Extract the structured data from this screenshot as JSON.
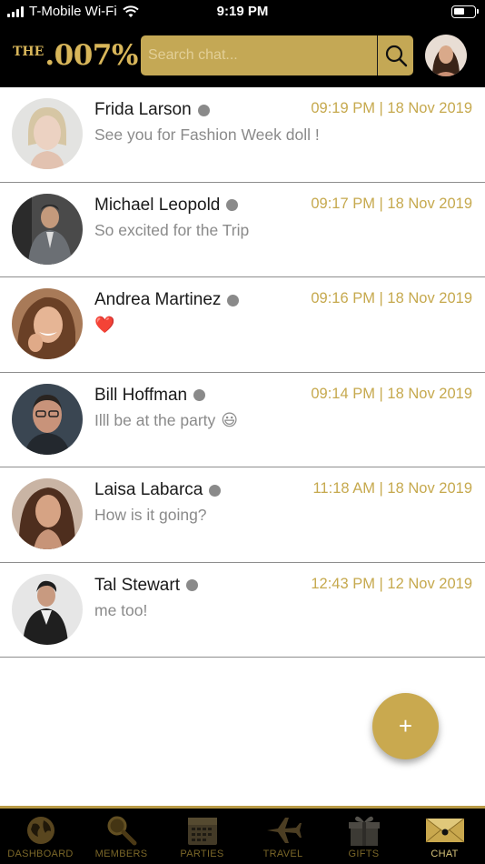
{
  "status_bar": {
    "carrier": "T-Mobile Wi-Fi",
    "time": "9:19 PM"
  },
  "header": {
    "logo_the": "THE",
    "logo_number": ".007%",
    "search_placeholder": "Search chat..."
  },
  "chats": [
    {
      "name": "Frida Larson",
      "time": "09:19 PM | 18 Nov 2019",
      "preview": "See you for Fashion Week doll !",
      "emoji": ""
    },
    {
      "name": "Michael Leopold",
      "time": "09:17 PM | 18 Nov 2019",
      "preview": "So excited for the Trip",
      "emoji": ""
    },
    {
      "name": "Andrea Martinez",
      "time": "09:16 PM | 18 Nov 2019",
      "preview": "",
      "emoji": "❤️"
    },
    {
      "name": "Bill Hoffman",
      "time": "09:14 PM | 18 Nov 2019",
      "preview": "Illl be at the party",
      "emoji": "😃"
    },
    {
      "name": "Laisa Labarca",
      "time": "11:18 AM | 18 Nov 2019",
      "preview": "How is it going?",
      "emoji": ""
    },
    {
      "name": "Tal Stewart",
      "time": "12:43 PM | 12 Nov 2019",
      "preview": "me too!",
      "emoji": ""
    }
  ],
  "fab": {
    "label": "+"
  },
  "tabs": [
    {
      "label": "DASHBOARD",
      "icon": "globe-icon"
    },
    {
      "label": "MEMBERS",
      "icon": "magnifier-icon"
    },
    {
      "label": "PARTIES",
      "icon": "calendar-icon"
    },
    {
      "label": "TRAVEL",
      "icon": "airplane-icon"
    },
    {
      "label": "GIFTS",
      "icon": "gift-box-icon"
    },
    {
      "label": "CHAT",
      "icon": "envelope-icon"
    }
  ],
  "colors": {
    "gold": "#c6a94e",
    "header_bg": "#000000",
    "search_bg": "#c4a855",
    "online_dot": "#8a8a8a"
  }
}
